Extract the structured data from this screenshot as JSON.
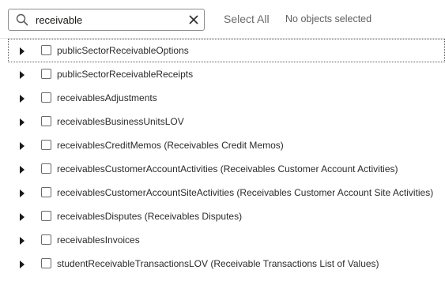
{
  "search": {
    "value": "receivable",
    "clear_icon": "close-icon",
    "search_icon": "search-icon"
  },
  "toolbar": {
    "select_all_label": "Select All",
    "selection_status": "No objects selected"
  },
  "items": [
    {
      "label": "publicSectorReceivableOptions",
      "focused": true
    },
    {
      "label": "publicSectorReceivableReceipts"
    },
    {
      "label": "receivablesAdjustments"
    },
    {
      "label": "receivablesBusinessUnitsLOV"
    },
    {
      "label": "receivablesCreditMemos (Receivables Credit Memos)"
    },
    {
      "label": "receivablesCustomerAccountActivities (Receivables Customer Account Activities)"
    },
    {
      "label": "receivablesCustomerAccountSiteActivities (Receivables Customer Account Site Activities)"
    },
    {
      "label": "receivablesDisputes (Receivables Disputes)"
    },
    {
      "label": "receivablesInvoices"
    },
    {
      "label": "studentReceivableTransactionsLOV (Receivable Transactions List of Values)"
    }
  ]
}
